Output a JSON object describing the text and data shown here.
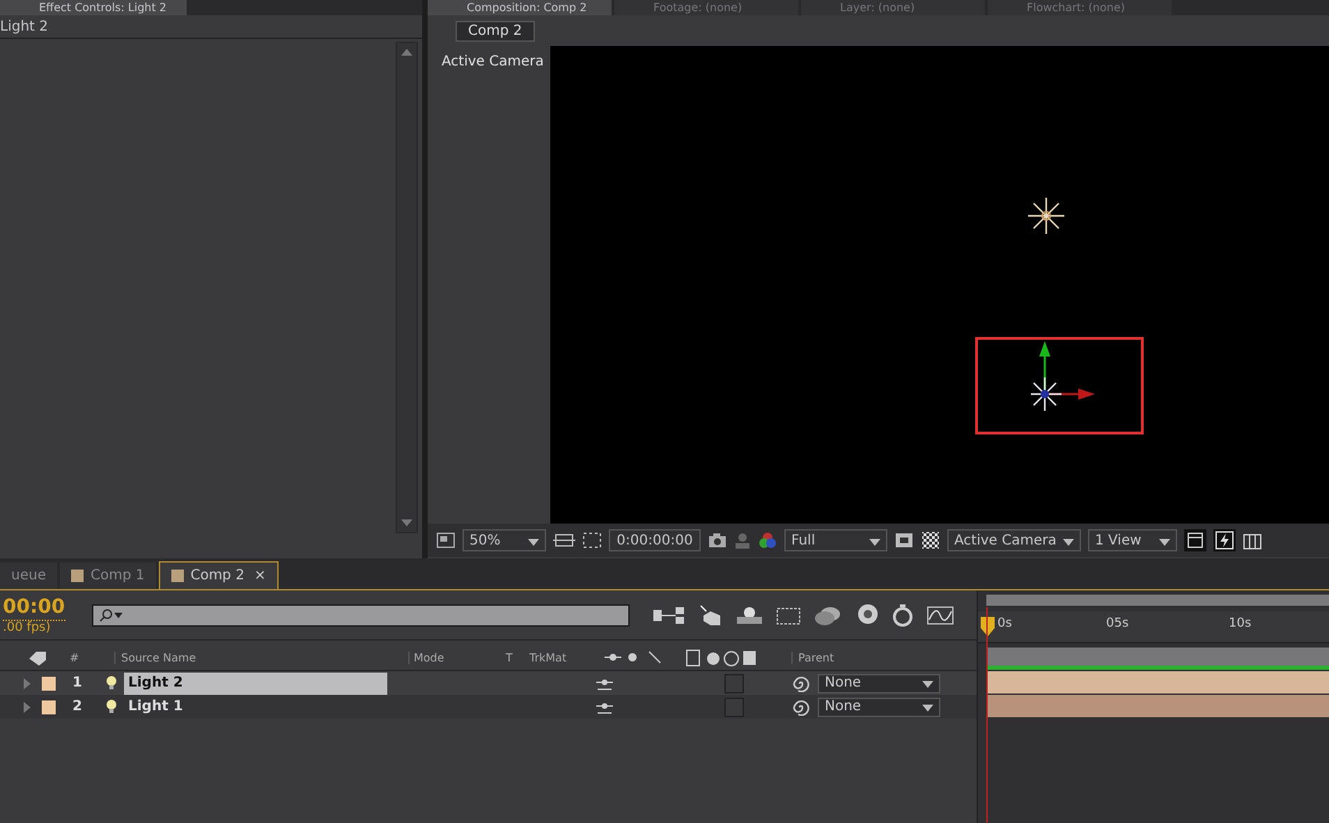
{
  "left_panel": {
    "tabs": [
      {
        "label": "Effect Controls: Light 2",
        "selected": true
      }
    ],
    "layer_label": "Light 2"
  },
  "right_panel": {
    "tabs": [
      {
        "label": "Composition: Comp 2",
        "selected": true
      },
      {
        "label": "Footage: (none)",
        "selected": false
      },
      {
        "label": "Layer: (none)",
        "selected": false
      },
      {
        "label": "Flowchart: (none)",
        "selected": false
      }
    ],
    "comp_button": "Comp 2",
    "view_label": "Active Camera",
    "toolbar": {
      "zoom": "50%",
      "timecode": "0:00:00:00",
      "resolution": "Full",
      "camera": "Active Camera",
      "views": "1 View"
    }
  },
  "timeline": {
    "tabs": [
      {
        "label": "ueue",
        "selected": false
      },
      {
        "label": "Comp 1",
        "selected": false
      },
      {
        "label": "Comp 2",
        "selected": true,
        "close": "×"
      }
    ],
    "timecode": "00:00",
    "fps": ".00 fps)",
    "columns": {
      "number": "#",
      "source_name": "Source Name",
      "mode": "Mode",
      "t": "T",
      "trkmat": "TrkMat",
      "parent": "Parent"
    },
    "layers": [
      {
        "number": "1",
        "name": "Light 2",
        "selected": true,
        "checked": false,
        "parent": "None"
      },
      {
        "number": "2",
        "name": "Light 1",
        "selected": false,
        "checked": false,
        "parent": "None"
      }
    ],
    "ruler": [
      "0s",
      "05s",
      "10s"
    ]
  }
}
